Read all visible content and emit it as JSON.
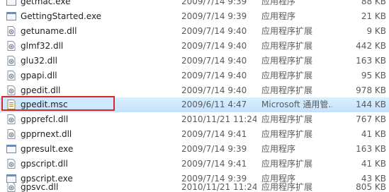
{
  "files": [
    {
      "name": "getmac.exe",
      "date": "2009/7/14 9:39",
      "type": "应用程序",
      "size": "88 KB",
      "icon": "exe-icon"
    },
    {
      "name": "GettingStarted.exe",
      "date": "2009/7/14 9:39",
      "type": "应用程序",
      "size": "21 KB",
      "icon": "exe-icon"
    },
    {
      "name": "getuname.dll",
      "date": "2009/7/14 9:40",
      "type": "应用程序扩展",
      "size": "9 KB",
      "icon": "dll-icon"
    },
    {
      "name": "glmf32.dll",
      "date": "2009/7/14 9:40",
      "type": "应用程序扩展",
      "size": "442 KB",
      "icon": "dll-icon"
    },
    {
      "name": "glu32.dll",
      "date": "2009/7/14 9:40",
      "type": "应用程序扩展",
      "size": "163 KB",
      "icon": "dll-icon"
    },
    {
      "name": "gpapi.dll",
      "date": "2009/7/14 9:40",
      "type": "应用程序扩展",
      "size": "95 KB",
      "icon": "dll-icon"
    },
    {
      "name": "gpedit.dll",
      "date": "2009/7/14 9:40",
      "type": "应用程序扩展",
      "size": "978 KB",
      "icon": "dll-icon"
    },
    {
      "name": "gpedit.msc",
      "date": "2009/6/11 4:47",
      "type": "Microsoft 通用管...",
      "size": "144 KB",
      "icon": "msc-icon",
      "selected": true
    },
    {
      "name": "gpprefcl.dll",
      "date": "2010/11/21 11:24",
      "type": "应用程序扩展",
      "size": "767 KB",
      "icon": "dll-icon"
    },
    {
      "name": "gpprnext.dll",
      "date": "2009/7/14 9:41",
      "type": "应用程序扩展",
      "size": "41 KB",
      "icon": "dll-icon"
    },
    {
      "name": "gpresult.exe",
      "date": "2009/7/14 9:39",
      "type": "应用程序",
      "size": "163 KB",
      "icon": "exe-icon"
    },
    {
      "name": "gpscript.dll",
      "date": "2009/7/14 9:41",
      "type": "应用程序扩展",
      "size": "41 KB",
      "icon": "dll-icon"
    },
    {
      "name": "gpscript.exe",
      "date": "2009/7/14 9:39",
      "type": "应用程序",
      "size": "43 KB",
      "icon": "exe-icon"
    },
    {
      "name": "gpsvc.dll",
      "date": "2010/11/21 11:24",
      "type": "应用程序扩展",
      "size": "805 KB",
      "icon": "dll-icon"
    }
  ]
}
